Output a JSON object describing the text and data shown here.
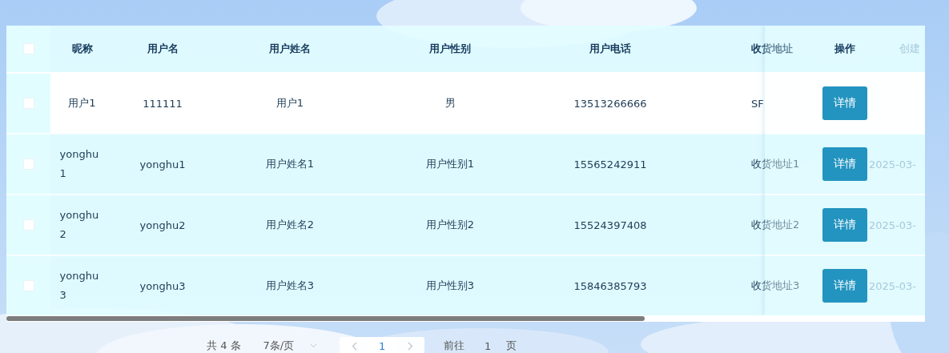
{
  "table": {
    "select_all": {
      "checked": false
    },
    "columns": [
      {
        "label": "昵称"
      },
      {
        "label": "用户名"
      },
      {
        "label": "用户姓名"
      },
      {
        "label": "用户性别"
      },
      {
        "label": "用户电话"
      },
      {
        "label": "收货地址"
      },
      {
        "label": "创建"
      }
    ],
    "action_column": "操作",
    "rows": [
      {
        "checked": false,
        "highlighted": true,
        "nickname": "用户1",
        "username": "111111",
        "real_name": "用户1",
        "gender": "男",
        "phone": "13513266666",
        "address": "SF",
        "action": "详情"
      },
      {
        "checked": false,
        "highlighted": false,
        "nickname": "yonghu1",
        "username": "yonghu1",
        "real_name": "用户姓名1",
        "gender": "用户性别1",
        "phone": "15565242911",
        "address": "收货地址1",
        "created": "2025-03-",
        "action": "详情"
      },
      {
        "checked": false,
        "highlighted": false,
        "nickname": "yonghu2",
        "username": "yonghu2",
        "real_name": "用户姓名2",
        "gender": "用户性别2",
        "phone": "15524397408",
        "address": "收货地址2",
        "created": "2025-03-",
        "action": "详情"
      },
      {
        "checked": false,
        "highlighted": false,
        "nickname": "yonghu3",
        "username": "yonghu3",
        "real_name": "用户姓名3",
        "gender": "用户性别3",
        "phone": "15846385793",
        "address": "收货地址3",
        "created": "2025-03-",
        "action": "详情"
      }
    ]
  },
  "pagination": {
    "total": "共 4 条",
    "page_size": "7条/页",
    "pages": [
      {
        "label": "1",
        "selected": true
      }
    ],
    "goto_label": "前往",
    "goto_value": "1",
    "goto_suffix": "页"
  }
}
